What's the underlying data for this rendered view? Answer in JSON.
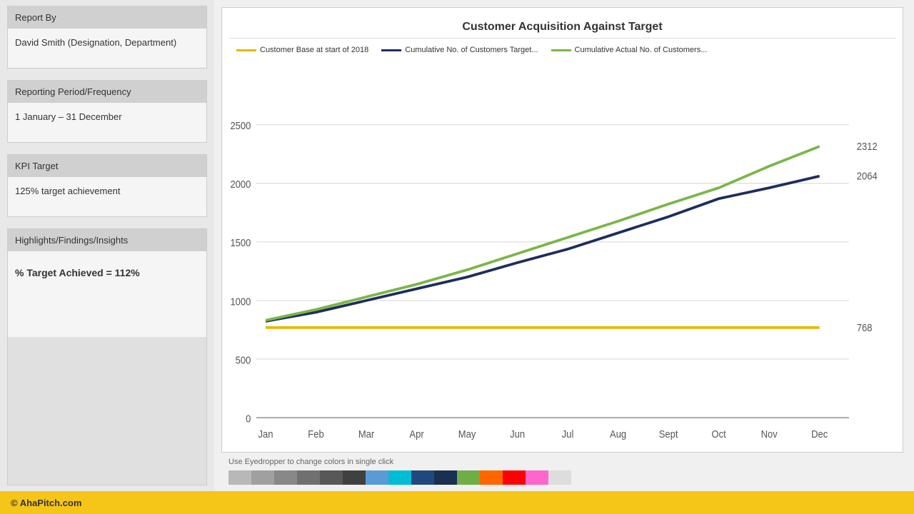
{
  "sidebar": {
    "report_by_label": "Report By",
    "report_by_value": "David Smith (Designation, Department)",
    "reporting_period_label": "Reporting Period/Frequency",
    "reporting_period_value": "1 January – 31 December",
    "kpi_target_label": "KPI Target",
    "kpi_target_value": "125% target achievement",
    "highlights_label": "Highlights/Findings/Insights",
    "highlights_value": "% Target Achieved = 112%"
  },
  "chart": {
    "title": "Customer Acquisition Against Target",
    "legend": [
      {
        "label": "Customer Base at start of 2018",
        "color": "#e6b800"
      },
      {
        "label": "Cumulative No. of Customers Target...",
        "color": "#1f2d5c"
      },
      {
        "label": "Cumulative Actual No. of Customers...",
        "color": "#7ab648"
      }
    ],
    "y_labels": [
      "0",
      "500",
      "1000",
      "1500",
      "2000",
      "2500"
    ],
    "x_labels": [
      "Jan",
      "Feb",
      "Mar",
      "Apr",
      "May",
      "Jun",
      "Jul",
      "Aug",
      "Sept",
      "Oct",
      "Nov",
      "Dec"
    ],
    "end_labels": {
      "baseline": "768",
      "target": "2064",
      "actual": "2312"
    },
    "series": {
      "baseline": [
        768,
        768,
        768,
        768,
        768,
        768,
        768,
        768,
        768,
        768,
        768,
        768
      ],
      "target": [
        820,
        900,
        1000,
        1100,
        1200,
        1320,
        1440,
        1580,
        1720,
        1870,
        1960,
        2064
      ],
      "actual": [
        830,
        920,
        1030,
        1140,
        1260,
        1400,
        1540,
        1680,
        1820,
        1960,
        2150,
        2312
      ]
    }
  },
  "footer": {
    "copyright": "© AhaPitch.com"
  },
  "eyedropper_text": "Use Eyedropper to change colors in single click",
  "palette_colors": [
    "#b0b0b0",
    "#999999",
    "#808080",
    "#686868",
    "#505050",
    "#383838",
    "#5b9bd5",
    "#00bcd4",
    "#1f497d",
    "#243f60",
    "#70ad47",
    "#ff6600",
    "#ff0000",
    "#ff66cc",
    "#cccccc"
  ]
}
